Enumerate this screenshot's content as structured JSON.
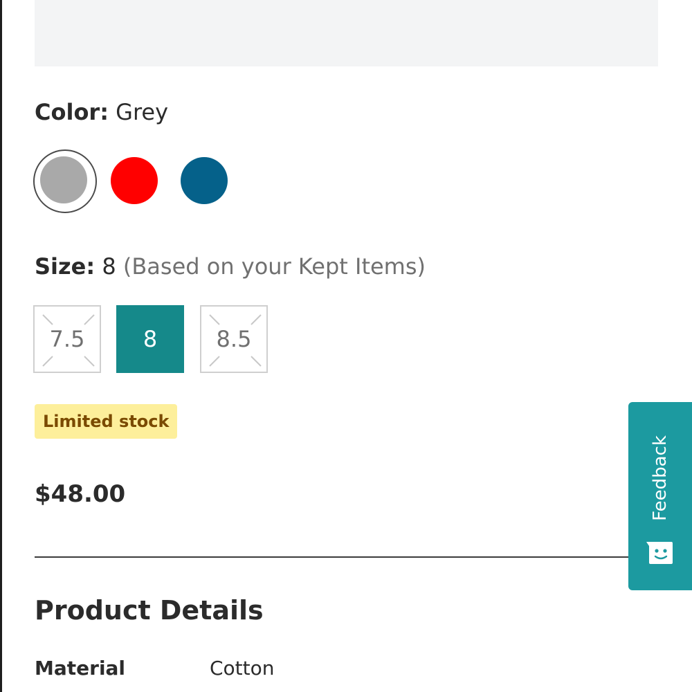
{
  "color": {
    "label": "Color:",
    "selected": "Grey",
    "swatches": [
      {
        "name": "Grey",
        "hex": "#a9a9a9",
        "selected": true
      },
      {
        "name": "Red",
        "hex": "#ff0000",
        "selected": false
      },
      {
        "name": "Blue",
        "hex": "#05618a",
        "selected": false
      }
    ]
  },
  "size": {
    "label": "Size:",
    "selected": "8",
    "note": "(Based on your Kept Items)",
    "options": [
      {
        "label": "7.5",
        "available": false,
        "selected": false
      },
      {
        "label": "8",
        "available": true,
        "selected": true
      },
      {
        "label": "8.5",
        "available": false,
        "selected": false
      }
    ]
  },
  "stock_badge": "Limited stock",
  "price": "$48.00",
  "details": {
    "title": "Product Details",
    "rows": [
      {
        "key": "Material",
        "value": "Cotton"
      }
    ]
  },
  "feedback": {
    "label": "Feedback",
    "icon": "chat-face-icon"
  },
  "colors": {
    "accent": "#15898a",
    "feedback_bg": "#1c9aa0",
    "badge_bg": "#fdef9b",
    "badge_text": "#7a4a00"
  }
}
